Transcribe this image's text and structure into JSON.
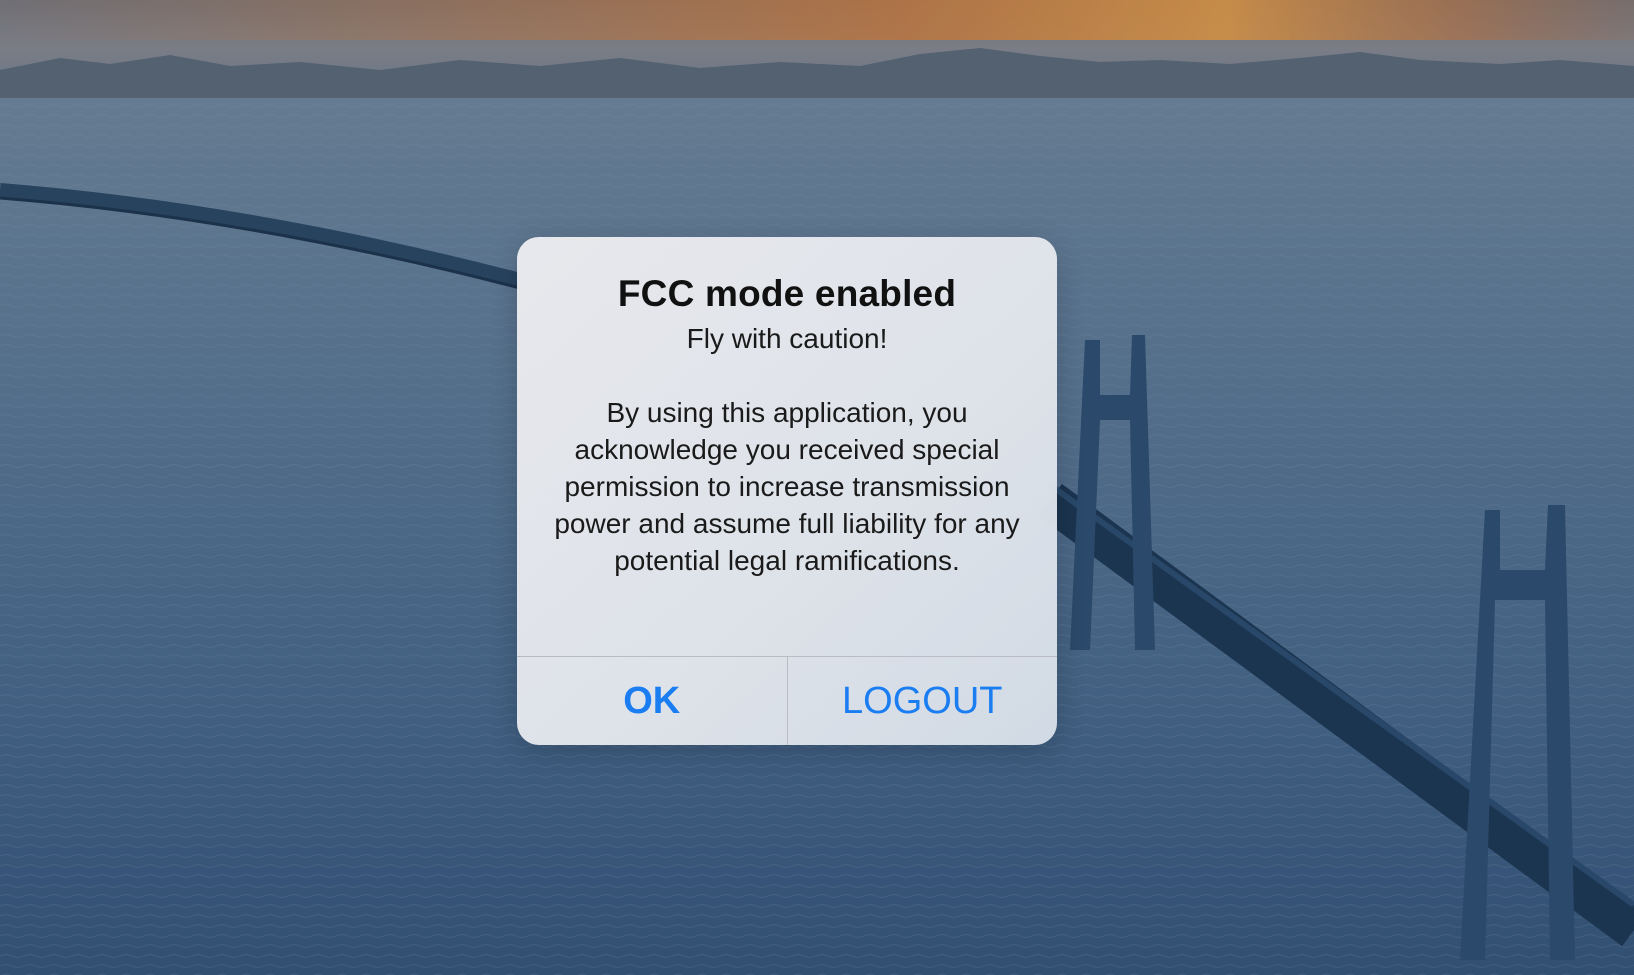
{
  "alert": {
    "title": "FCC mode enabled",
    "subtitle": "Fly with caution!",
    "message": "By using this application, you acknowledge you received special permission to increase transmission power and assume full liability for any potential legal ramifications.",
    "buttons": {
      "ok": "OK",
      "logout": "LOGOUT"
    }
  },
  "colors": {
    "button_text": "#1a7df2",
    "dialog_background": "#e6e9ee"
  }
}
